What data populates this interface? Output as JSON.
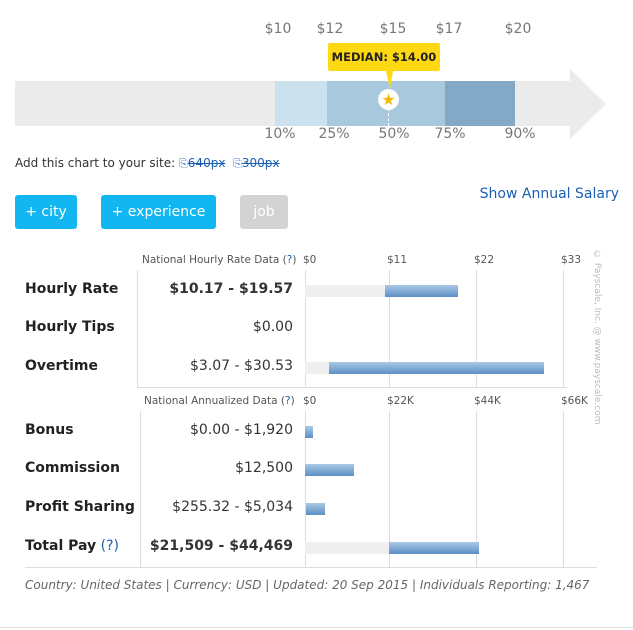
{
  "percentile_chart": {
    "top_labels": [
      "$10",
      "$12",
      "$15",
      "$17",
      "$20"
    ],
    "bottom_labels": [
      "10%",
      "25%",
      "50%",
      "75%",
      "90%"
    ],
    "median_label": "MEDIAN: $14.00",
    "colors": {
      "p10_25": "#cce1ee",
      "p25_75": "#a8c8de",
      "p75_90": "#84a9c6",
      "track": "#ebebeb",
      "median": "#ffd814"
    }
  },
  "embed": {
    "label": "Add this chart to your site:",
    "link_640": "640px",
    "link_300": "300px"
  },
  "buttons": {
    "city": "+ city",
    "experience": "+ experience",
    "job": "job"
  },
  "show_annual": "Show Annual Salary",
  "hourly": {
    "header": "National Hourly Rate Data",
    "help": "?",
    "ticks": [
      "$0",
      "$11",
      "$22",
      "$33"
    ],
    "axis_max": 33,
    "rows": [
      {
        "label": "Hourly Rate",
        "value": "$10.17 - $19.57",
        "low": 10.17,
        "high": 19.57,
        "bold": true
      },
      {
        "label": "Hourly Tips",
        "value": "$0.00",
        "low": 0,
        "high": 0
      },
      {
        "label": "Overtime",
        "value": "$3.07 - $30.53",
        "low": 3.07,
        "high": 30.53
      }
    ]
  },
  "annual": {
    "header": "National Annualized Data",
    "help": "?",
    "ticks": [
      "$0",
      "$22K",
      "$44K",
      "$66K"
    ],
    "axis_max": 66000,
    "rows": [
      {
        "label": "Bonus",
        "value": "$0.00 - $1,920",
        "low": 0,
        "high": 1920
      },
      {
        "label": "Commission",
        "value": "$12,500",
        "low": 0,
        "high": 12500
      },
      {
        "label": "Profit Sharing",
        "value": "$255.32 - $5,034",
        "low": 255.32,
        "high": 5034
      },
      {
        "label": "Total Pay",
        "help": "(?)",
        "value": "$21,509 - $44,469",
        "low": 21509,
        "high": 44469,
        "bold": true
      }
    ]
  },
  "watermark": "© Payscale, Inc. @ www.payscale.com",
  "footer": "Country: United States | Currency: USD | Updated: 20 Sep 2015 | Individuals Reporting: 1,467"
}
